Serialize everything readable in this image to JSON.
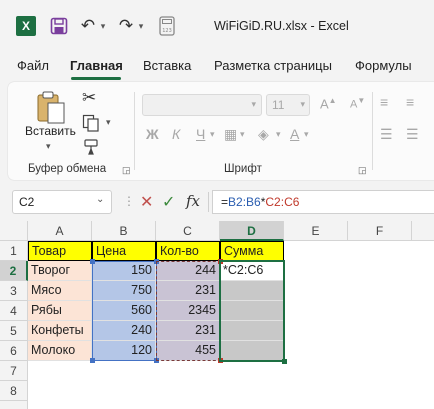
{
  "window": {
    "title": "WiFiGiD.RU.xlsx  -  Excel",
    "icons": [
      "excel-logo",
      "save-icon",
      "undo-icon",
      "redo-icon",
      "calculator-icon"
    ],
    "excel_logo_letter": "X"
  },
  "ribbon_tabs": [
    "Файл",
    "Главная",
    "Вставка",
    "Разметка страницы",
    "Формулы"
  ],
  "active_tab": "Главная",
  "ribbon": {
    "clipboard": {
      "paste_label": "Вставить",
      "group_label": "Буфер обмена"
    },
    "font": {
      "font_name_value": "",
      "font_size_value": "11",
      "bold": "Ж",
      "italic": "К",
      "underline": "Ч",
      "group_label": "Шрифт"
    }
  },
  "formula_bar": {
    "name_box": "C2",
    "formula_prefix": "=",
    "formula_ref1": "B2:B6",
    "formula_op": "*",
    "formula_ref2": "C2:C6"
  },
  "sheet": {
    "columns": [
      "A",
      "B",
      "C",
      "D",
      "E",
      "F"
    ],
    "selected_column": "D",
    "rows": [
      "1",
      "2",
      "3",
      "4",
      "5",
      "6",
      "7",
      "8"
    ],
    "selected_row": "2",
    "header_row": [
      "Товар",
      "Цена",
      "Кол-во",
      "Сумма"
    ],
    "data": [
      {
        "product": "Творог",
        "price": "150",
        "qty": "244",
        "sum": "*C2:C6"
      },
      {
        "product": "Мясо",
        "price": "750",
        "qty": "231",
        "sum": ""
      },
      {
        "product": "Рябы",
        "price": "560",
        "qty": "2345",
        "sum": ""
      },
      {
        "product": "Конфеты",
        "price": "240",
        "qty": "231",
        "sum": ""
      },
      {
        "product": "Молоко",
        "price": "120",
        "qty": "455",
        "sum": ""
      }
    ]
  },
  "colors": {
    "excel_green": "#1d6f42",
    "header_fill": "#ffff00",
    "product_fill": "#fce4d6",
    "price_fill": "#b4c6e7",
    "qty_fill": "#c9c3d4",
    "sum_fill": "#c8c8c8",
    "ref_blue": "#2a5db0",
    "ref_red": "#c0392b"
  }
}
